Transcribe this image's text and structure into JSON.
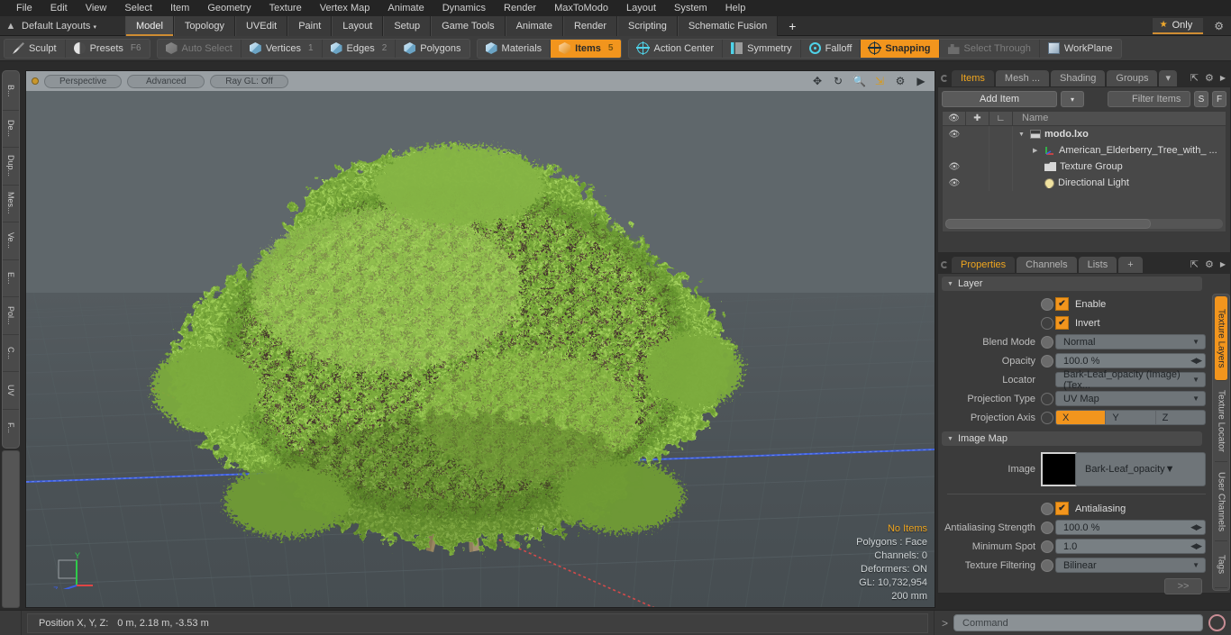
{
  "menubar": {
    "items": [
      "File",
      "Edit",
      "View",
      "Select",
      "Item",
      "Geometry",
      "Texture",
      "Vertex Map",
      "Animate",
      "Dynamics",
      "Render",
      "MaxToModo",
      "Layout",
      "System",
      "Help"
    ]
  },
  "layoutbar": {
    "home_icon": "home-icon",
    "layouts_label": "Default Layouts",
    "caret": "▾",
    "tabs": [
      {
        "label": "Model",
        "active": true
      },
      {
        "label": "Topology",
        "active": false
      },
      {
        "label": "UVEdit",
        "active": false
      },
      {
        "label": "Paint",
        "active": false
      },
      {
        "label": "Layout",
        "active": false
      },
      {
        "label": "Setup",
        "active": false
      },
      {
        "label": "Game Tools",
        "active": false
      },
      {
        "label": "Animate",
        "active": false
      },
      {
        "label": "Render",
        "active": false
      },
      {
        "label": "Scripting",
        "active": false
      },
      {
        "label": "Schematic Fusion",
        "active": false
      }
    ],
    "add_tab": "+",
    "only_label": "Only",
    "star_icon": "★",
    "gear_icon": "gear-icon",
    "accent": "#cf8d33"
  },
  "modebar": {
    "group1": [
      {
        "label": "Sculpt",
        "icon": "pencil-icon",
        "state": "normal",
        "num": ""
      },
      {
        "label": "Presets",
        "icon": "preset-icon",
        "state": "normal",
        "num": "F6"
      }
    ],
    "group2": [
      {
        "label": "Auto Select",
        "icon": "cube-icon",
        "state": "dim",
        "num": ""
      },
      {
        "label": "Vertices",
        "icon": "cube-icon",
        "state": "normal",
        "num": "1"
      },
      {
        "label": "Edges",
        "icon": "cube-icon",
        "state": "normal",
        "num": "2"
      },
      {
        "label": "Polygons",
        "icon": "cube-icon",
        "state": "normal",
        "num": ""
      }
    ],
    "group3": [
      {
        "label": "Materials",
        "icon": "cube-icon",
        "state": "normal",
        "num": ""
      },
      {
        "label": "Items",
        "icon": "cube-icon",
        "state": "on",
        "num": "5"
      }
    ],
    "group4": [
      {
        "label": "Action Center",
        "icon": "crosshair-icon",
        "state": "normal",
        "num": ""
      },
      {
        "label": "Symmetry",
        "icon": "symmetry-icon",
        "state": "normal",
        "num": ""
      },
      {
        "label": "Falloff",
        "icon": "falloff-icon",
        "state": "normal",
        "num": ""
      },
      {
        "label": "Snapping",
        "icon": "crosshair-icon",
        "state": "on",
        "num": ""
      },
      {
        "label": "Select Through",
        "icon": "select-through-icon",
        "state": "dim",
        "num": ""
      },
      {
        "label": "WorkPlane",
        "icon": "workplane-icon",
        "state": "normal",
        "num": ""
      }
    ],
    "accent": "#f2951d"
  },
  "left_rail": {
    "tabs": [
      "B...",
      "De...",
      "Dup...",
      "Mes...",
      "Ve...",
      "E...",
      "Pol...",
      "C...",
      "UV",
      "F..."
    ]
  },
  "viewport": {
    "dot": "viewport-indicator",
    "pills": [
      "Perspective",
      "Advanced",
      "Ray GL: Off"
    ],
    "icons": [
      "move-icon",
      "rotate-icon",
      "zoom-icon",
      "fit-icon",
      "gear-icon",
      "play-icon"
    ],
    "gizmo": {
      "x": "X",
      "y": "Y",
      "z": "Z"
    },
    "stats": {
      "selection": "No Items",
      "polygons": "Polygons : Face",
      "channels": "Channels: 0",
      "deformers": "Deformers: ON",
      "gl": "GL: 10,732,954",
      "scale": "200 mm"
    },
    "colors": {
      "bg": "#5c6468",
      "ground": "#4e565a",
      "axis_z": "#3d5fe0",
      "axis_x": "#e04545"
    }
  },
  "items_panel": {
    "tabs": [
      {
        "label": "Items",
        "active": true
      },
      {
        "label": "Mesh ...",
        "active": false
      },
      {
        "label": "Shading",
        "active": false
      },
      {
        "label": "Groups",
        "active": false
      }
    ],
    "tab_extra": "▾",
    "header_icons": [
      "expand-icon",
      "gear-icon",
      "chevron-right-icon"
    ],
    "add_item_label": "Add Item",
    "add_item_caret": "▾",
    "filter_placeholder": "Filter Items",
    "filter_icon": "search-icon",
    "s_button": "S",
    "f_button": "F",
    "columns": [
      "eye-icon",
      "locator-icon",
      "axis-icon",
      "Name"
    ],
    "rows": [
      {
        "eye": "👁",
        "name": "modo.lxo",
        "icon": "scene-icon",
        "indent": 0,
        "twisty": "▼",
        "bold": true
      },
      {
        "eye": "",
        "name": "American_Elderberry_Tree_with_ ...",
        "icon": "mesh-icon",
        "indent": 1,
        "twisty": "▶",
        "bold": false
      },
      {
        "eye": "👁",
        "name": "Texture Group",
        "icon": "folder-icon",
        "indent": 1,
        "twisty": "",
        "bold": false
      },
      {
        "eye": "👁",
        "name": "Directional Light",
        "icon": "light-icon",
        "indent": 1,
        "twisty": "",
        "bold": false
      }
    ]
  },
  "properties_panel": {
    "tabs": [
      {
        "label": "Properties",
        "active": true
      },
      {
        "label": "Channels",
        "active": false
      },
      {
        "label": "Lists",
        "active": false
      },
      {
        "label": "+",
        "active": false
      }
    ],
    "header_icons": [
      "expand-icon",
      "gear-icon",
      "chevron-right-icon"
    ],
    "layer_section": {
      "title": "Layer",
      "enable": {
        "label": "Enable",
        "checked": true
      },
      "invert": {
        "label": "Invert",
        "checked": true
      },
      "blend_mode": {
        "label": "Blend Mode",
        "value": "Normal"
      },
      "opacity": {
        "label": "Opacity",
        "value": "100.0 %"
      },
      "locator": {
        "label": "Locator",
        "value": "Bark-Leaf_opacity (Image) (Tex..."
      },
      "projection_type": {
        "label": "Projection Type",
        "value": "UV Map"
      },
      "projection_axis": {
        "label": "Projection Axis",
        "options": [
          "X",
          "Y",
          "Z"
        ],
        "selected": "X"
      }
    },
    "image_map_section": {
      "title": "Image Map",
      "image": {
        "label": "Image",
        "value": "Bark-Leaf_opacity",
        "thumb": "black-thumbnail"
      },
      "antialiasing": {
        "label": "Antialiasing",
        "checked": true
      },
      "antialiasing_strength": {
        "label": "Antialiasing Strength",
        "value": "100.0 %"
      },
      "minimum_spot": {
        "label": "Minimum Spot",
        "value": "1.0"
      },
      "texture_filtering": {
        "label": "Texture Filtering",
        "value": "Bilinear"
      },
      "more_button": ">>"
    }
  },
  "right_rail": {
    "tabs": [
      {
        "label": "Texture Layers",
        "active": true
      },
      {
        "label": "Texture Locator",
        "active": false
      },
      {
        "label": "User Channels",
        "active": false
      },
      {
        "label": "Tags",
        "active": false
      }
    ]
  },
  "statusbar": {
    "position_label": "Position X, Y, Z:",
    "position_value": "0 m, 2.18 m, -3.53 m",
    "prompt": ">",
    "command_placeholder": "Command",
    "record_icon": "record-icon"
  }
}
